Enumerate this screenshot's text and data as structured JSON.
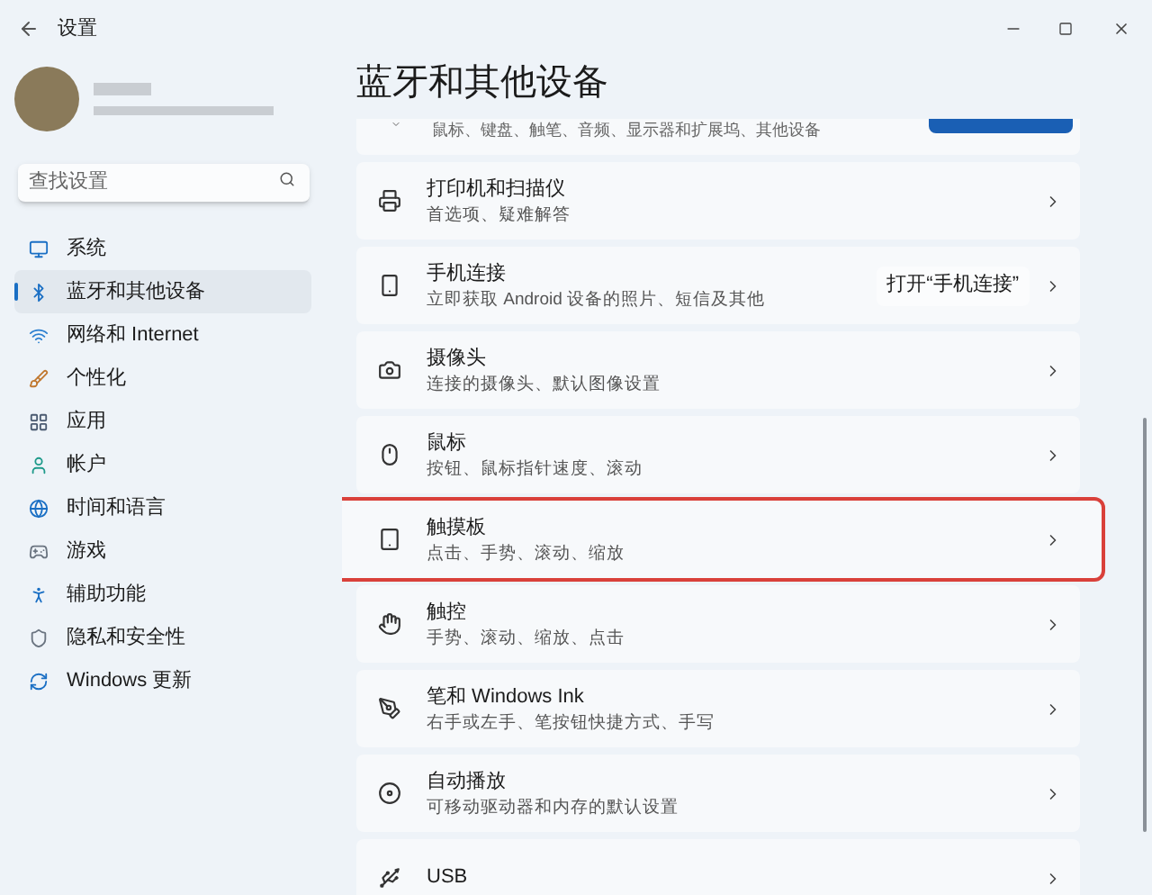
{
  "window": {
    "title": "设置"
  },
  "sidebar": {
    "search": {
      "placeholder": "查找设置"
    },
    "items": [
      {
        "label": "系统",
        "selected": false
      },
      {
        "label": "蓝牙和其他设备",
        "selected": true
      },
      {
        "label": "网络和 Internet",
        "selected": false
      },
      {
        "label": "个性化",
        "selected": false
      },
      {
        "label": "应用",
        "selected": false
      },
      {
        "label": "帐户",
        "selected": false
      },
      {
        "label": "时间和语言",
        "selected": false
      },
      {
        "label": "游戏",
        "selected": false
      },
      {
        "label": "辅助功能",
        "selected": false
      },
      {
        "label": "隐私和安全性",
        "selected": false
      },
      {
        "label": "Windows 更新",
        "selected": false
      }
    ]
  },
  "page": {
    "title": "蓝牙和其他设备",
    "cut_card": {
      "description": "鼠标、键盘、触笔、音频、显示器和扩展坞、其他设备"
    },
    "cards": [
      {
        "title": "打印机和扫描仪",
        "description": "首选项、疑难解答",
        "highlighted": false
      },
      {
        "title": "手机连接",
        "description": "立即获取 Android 设备的照片、短信及其他",
        "action": "打开“手机连接”",
        "highlighted": false
      },
      {
        "title": "摄像头",
        "description": "连接的摄像头、默认图像设置",
        "highlighted": false
      },
      {
        "title": "鼠标",
        "description": "按钮、鼠标指针速度、滚动",
        "highlighted": false
      },
      {
        "title": "触摸板",
        "description": "点击、手势、滚动、缩放",
        "highlighted": true
      },
      {
        "title": "触控",
        "description": "手势、滚动、缩放、点击",
        "highlighted": false
      },
      {
        "title": "笔和 Windows Ink",
        "description": "右手或左手、笔按钮快捷方式、手写",
        "highlighted": false
      },
      {
        "title": "自动播放",
        "description": "可移动驱动器和内存的默认设置",
        "highlighted": false
      },
      {
        "title": "USB",
        "highlighted": false
      }
    ]
  }
}
